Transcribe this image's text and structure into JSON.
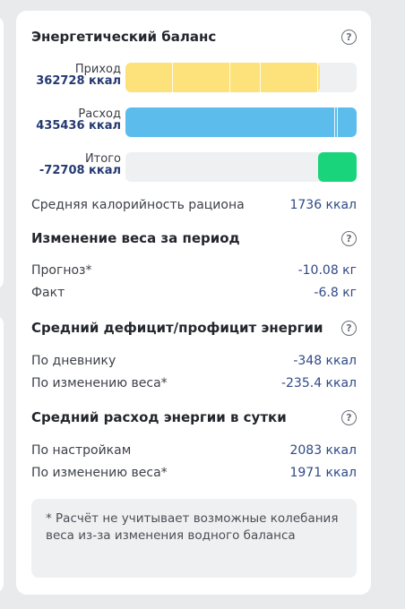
{
  "balance": {
    "title": "Энергетический баланс",
    "help_icon": "question-circle-icon",
    "income": {
      "label": "Приход",
      "value": "362728 ккал",
      "fill_fraction": 0.84,
      "color": "#fde17a",
      "segments": [
        0.2,
        0.45,
        0.58,
        0.83
      ]
    },
    "expense": {
      "label": "Расход",
      "value": "435436 ккал",
      "fill_fraction": 1.0,
      "color": "#5cbcec",
      "segments": [
        0.904,
        0.915
      ]
    },
    "total": {
      "label": "Итого",
      "value": "-72708 ккал",
      "fill_fraction": 0.168,
      "color": "#1ad47c"
    },
    "avg_calories": {
      "label": "Средняя калорийность рациона",
      "value": "1736 ккал"
    }
  },
  "weight_change": {
    "title": "Изменение веса за период",
    "forecast": {
      "label": "Прогноз*",
      "value": "-10.08 кг"
    },
    "fact": {
      "label": "Факт",
      "value": "-6.8 кг"
    }
  },
  "deficit": {
    "title": "Средний дефицит/профицит энергии",
    "by_diary": {
      "label": "По дневнику",
      "value": "-348 ккал"
    },
    "by_weight": {
      "label": "По изменению веса*",
      "value": "-235.4 ккал"
    }
  },
  "daily_expense": {
    "title": "Средний расход энергии в сутки",
    "by_settings": {
      "label": "По настройкам",
      "value": "2083 ккал"
    },
    "by_weight": {
      "label": "По изменению веса*",
      "value": "1971 ккал"
    }
  },
  "note": "* Расчёт не учитывает возможные колебания веса из-за изменения водного баланса",
  "colors": {
    "accent_text": "#2f4a86",
    "background": "#e9eaec",
    "card": "#ffffff"
  }
}
